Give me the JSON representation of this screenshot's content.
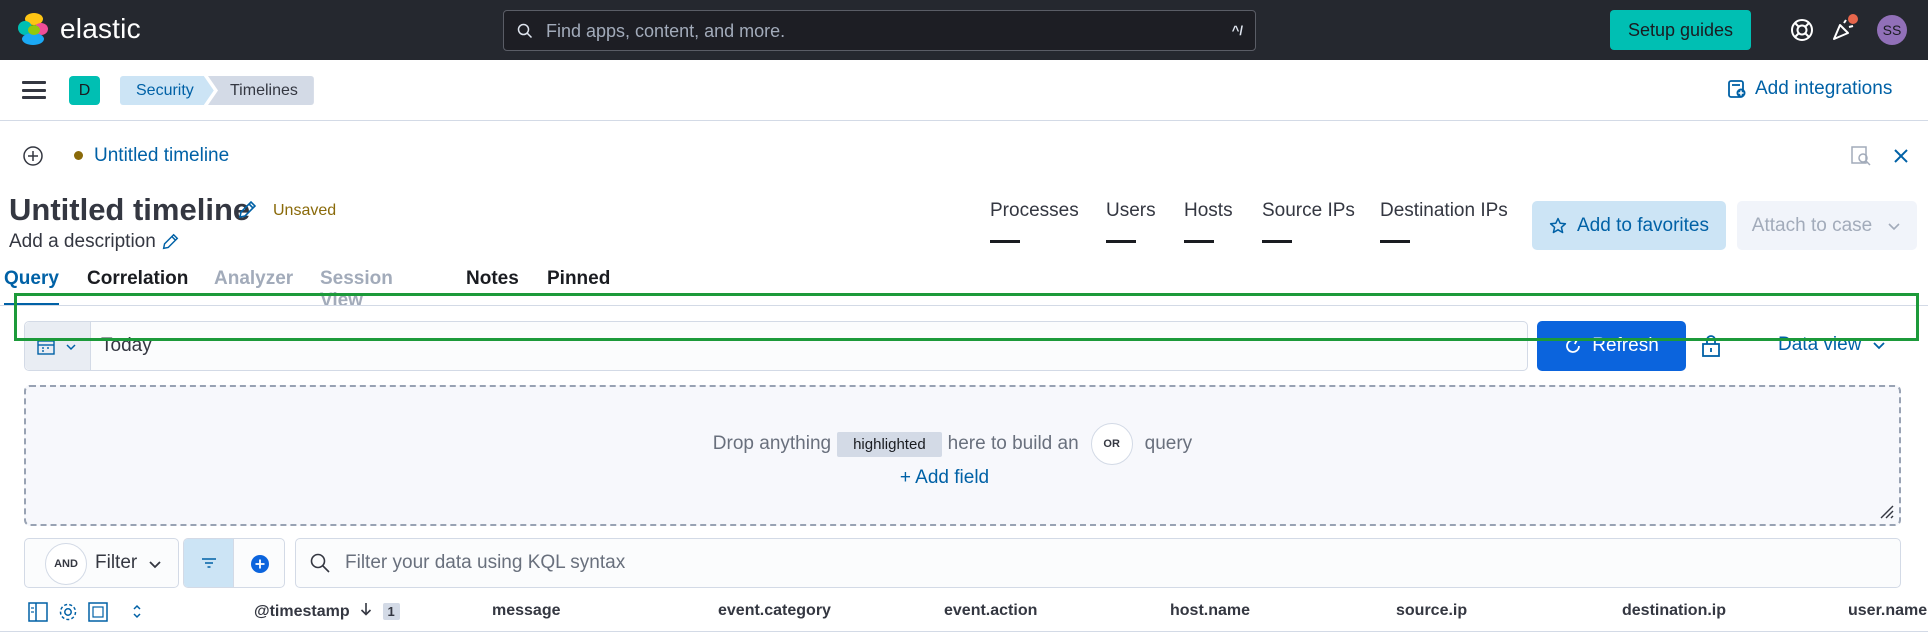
{
  "header": {
    "brand": "elastic",
    "search_placeholder": "Find apps, content, and more.",
    "search_shortcut": "^/",
    "setup_guides_label": "Setup guides",
    "avatar_initials": "SS",
    "colors": {
      "bar": "#25282f",
      "setup": "#00bfb3",
      "avatar": "#9170b8"
    }
  },
  "subheader": {
    "space_initial": "D",
    "breadcrumbs": [
      "Security",
      "Timelines"
    ],
    "add_integrations_label": "Add integrations"
  },
  "timeline": {
    "tab_link": "Untitled timeline",
    "title": "Untitled timeline",
    "status": "Unsaved",
    "description_placeholder": "Add a description",
    "kpis": [
      "Processes",
      "Users",
      "Hosts",
      "Source IPs",
      "Destination IPs"
    ],
    "kpi_value": "—",
    "add_favorites_label": "Add to favorites",
    "attach_case_label": "Attach to case"
  },
  "tabs": [
    {
      "label": "Query",
      "state": "active"
    },
    {
      "label": "Correlation",
      "state": "enabled"
    },
    {
      "label": "Analyzer",
      "state": "disabled"
    },
    {
      "label": "Session View",
      "state": "disabled"
    },
    {
      "label": "Notes",
      "state": "enabled"
    },
    {
      "label": "Pinned",
      "state": "enabled"
    }
  ],
  "query_bar": {
    "date_value": "Today",
    "refresh_label": "Refresh",
    "data_view_label": "Data view"
  },
  "drop_zone": {
    "text_before": "Drop anything",
    "chip": "highlighted",
    "text_after": "here to build an",
    "or_badge": "OR",
    "text_end": "query",
    "add_field_label": "+ Add field"
  },
  "filter_bar": {
    "and_badge": "AND",
    "filter_label": "Filter",
    "kql_placeholder": "Filter your data using KQL syntax"
  },
  "columns": {
    "timestamp": "@timestamp",
    "sort_count": "1",
    "items": [
      "message",
      "event.category",
      "event.action",
      "host.name",
      "source.ip",
      "destination.ip",
      "user.name"
    ]
  }
}
